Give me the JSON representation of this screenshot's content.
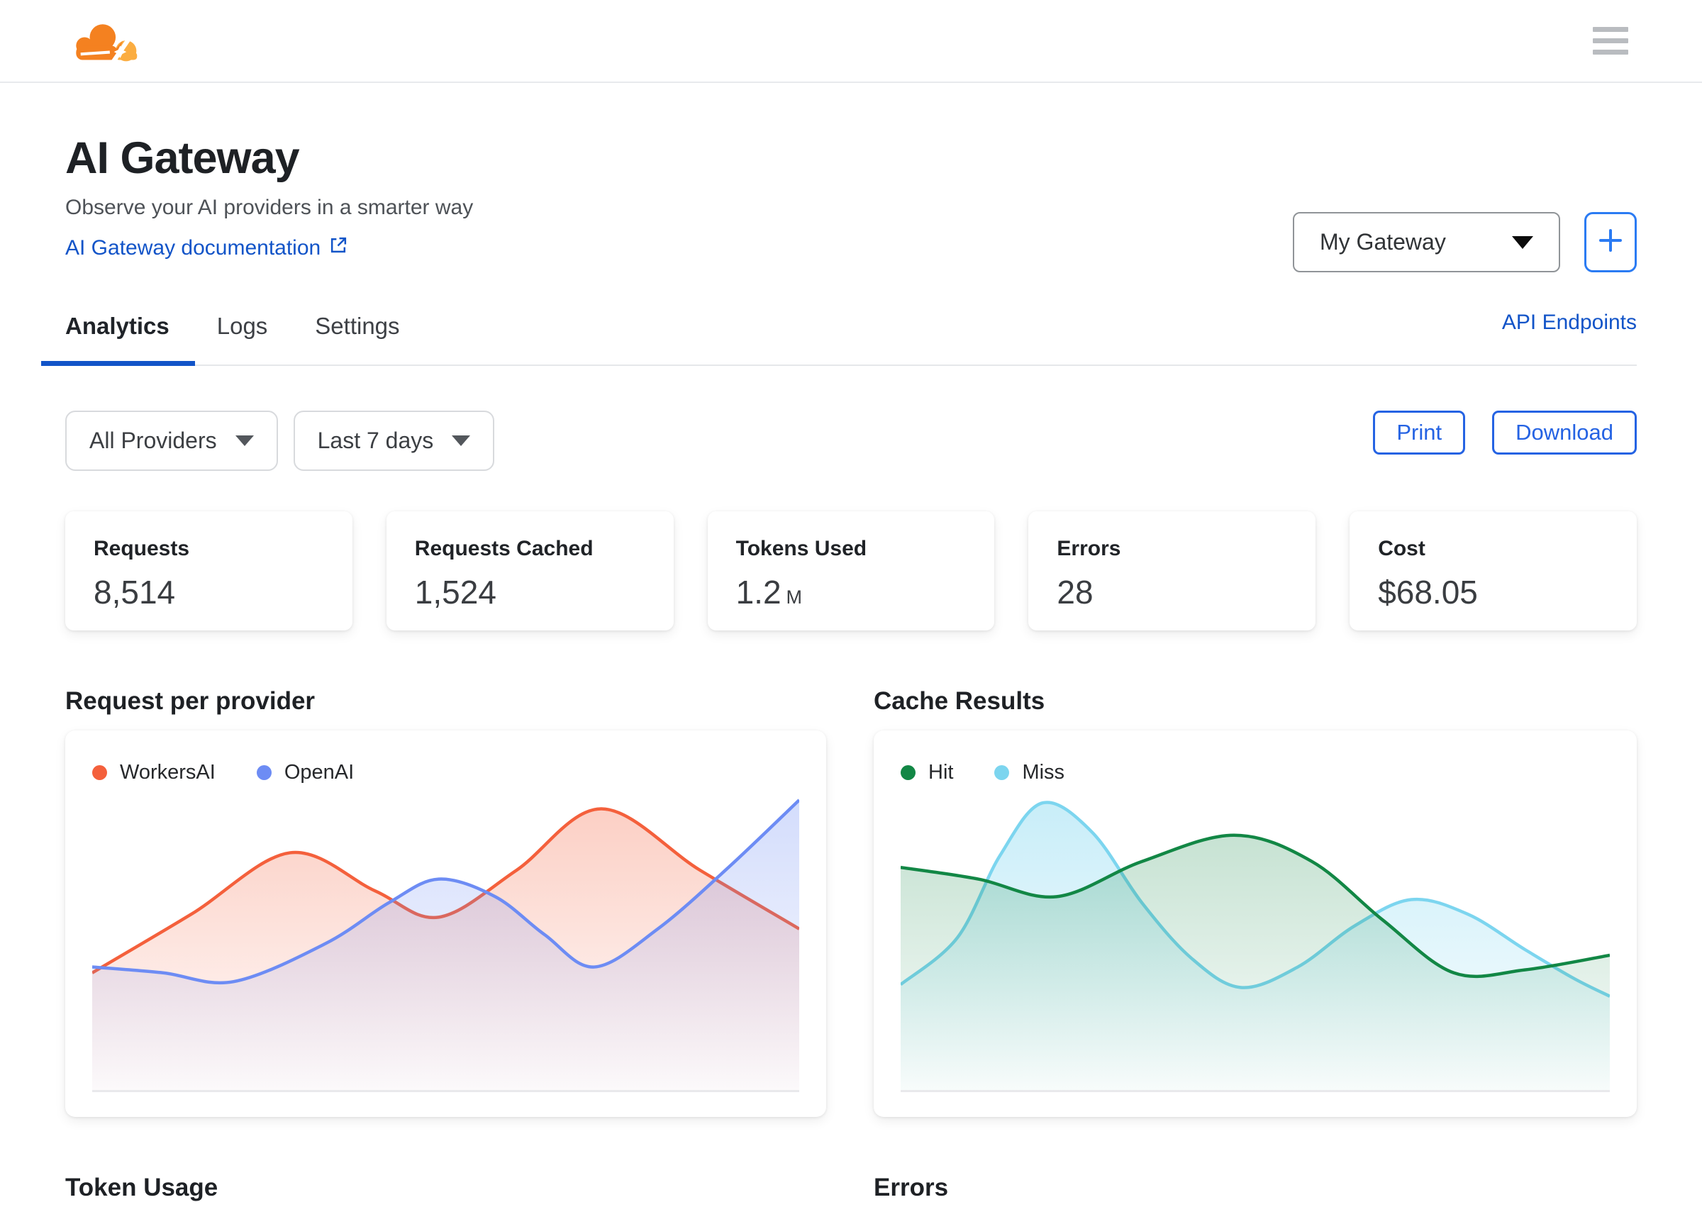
{
  "topbar": {
    "logo_icon": "cloudflare-cloud-logo",
    "menu_icon": "hamburger-menu"
  },
  "header": {
    "title": "AI Gateway",
    "subtitle": "Observe your AI providers in a smarter way",
    "doc_link": "AI Gateway documentation",
    "doc_link_icon": "external-link-icon",
    "gateway_select": {
      "value": "My Gateway",
      "icon": "caret-down-icon"
    },
    "add_button": {
      "icon": "plus-icon"
    }
  },
  "tabs": {
    "items": [
      {
        "label": "Analytics",
        "active": true
      },
      {
        "label": "Logs",
        "active": false
      },
      {
        "label": "Settings",
        "active": false
      }
    ],
    "right_link": "API Endpoints"
  },
  "filters": {
    "providers": {
      "value": "All Providers",
      "icon": "caret-down-icon"
    },
    "range": {
      "value": "Last 7 days",
      "icon": "caret-down-icon"
    }
  },
  "actions": {
    "print": "Print",
    "download": "Download"
  },
  "stats": [
    {
      "label": "Requests",
      "value": "8,514"
    },
    {
      "label": "Requests Cached",
      "value": "1,524"
    },
    {
      "label": "Tokens Used",
      "value": "1.2",
      "suffix": "M"
    },
    {
      "label": "Errors",
      "value": "28"
    },
    {
      "label": "Cost",
      "value": "$68.05"
    }
  ],
  "sections": {
    "requests_title": "Request per provider",
    "cache_title": "Cache Results",
    "token_usage_title": "Token Usage",
    "errors_title": "Errors"
  },
  "colors": {
    "accent_blue": "#1254c8",
    "button_blue": "#2563e3",
    "logo_orange": "#f48120",
    "logo_light_orange": "#fbad41"
  },
  "chart_data": [
    {
      "type": "area",
      "title": "Request per provider",
      "xlabel": "",
      "ylabel": "",
      "axes_visible": false,
      "note": "unlabeled smoothed area chart over last 7 days; values are relative heights 0-100",
      "legend_position": "top-left",
      "draw_order": [
        0,
        1
      ],
      "series": [
        {
          "name": "WorkersAI",
          "color": "#f4603c",
          "fill_opacity_top": 0.3,
          "points": [
            [
              0,
              40
            ],
            [
              14,
              60
            ],
            [
              28,
              81
            ],
            [
              40,
              68
            ],
            [
              49,
              59
            ],
            [
              60,
              75
            ],
            [
              72,
              96
            ],
            [
              86,
              75
            ],
            [
              100,
              55
            ]
          ]
        },
        {
          "name": "OpenAI",
          "color": "#6d8cf4",
          "fill_opacity_top": 0.3,
          "points": [
            [
              0,
              42
            ],
            [
              10,
              40
            ],
            [
              20,
              37
            ],
            [
              33,
              50
            ],
            [
              42,
              64
            ],
            [
              49,
              72
            ],
            [
              57,
              66
            ],
            [
              64,
              53
            ],
            [
              71,
              42
            ],
            [
              80,
              55
            ],
            [
              90,
              76
            ],
            [
              100,
              99
            ]
          ]
        }
      ]
    },
    {
      "type": "area",
      "title": "Cache Results",
      "xlabel": "",
      "ylabel": "",
      "axes_visible": false,
      "note": "unlabeled smoothed area chart over last 7 days; values are relative heights 0-100",
      "legend_position": "top-left",
      "draw_order": [
        1,
        0
      ],
      "series": [
        {
          "name": "Hit",
          "color": "#128745",
          "fill_opacity_top": 0.24,
          "points": [
            [
              0,
              76
            ],
            [
              11,
              72
            ],
            [
              22,
              66
            ],
            [
              34,
              78
            ],
            [
              47,
              87
            ],
            [
              58,
              78
            ],
            [
              68,
              58
            ],
            [
              78,
              40
            ],
            [
              88,
              41
            ],
            [
              100,
              46
            ]
          ]
        },
        {
          "name": "Miss",
          "color": "#7cd5ef",
          "fill_opacity_top": 0.42,
          "points": [
            [
              0,
              36
            ],
            [
              8,
              52
            ],
            [
              14,
              80
            ],
            [
              20,
              98
            ],
            [
              27,
              88
            ],
            [
              34,
              64
            ],
            [
              41,
              45
            ],
            [
              48,
              35
            ],
            [
              56,
              42
            ],
            [
              64,
              56
            ],
            [
              72,
              65
            ],
            [
              80,
              60
            ],
            [
              88,
              48
            ],
            [
              95,
              38
            ],
            [
              100,
              32
            ]
          ]
        }
      ]
    }
  ]
}
